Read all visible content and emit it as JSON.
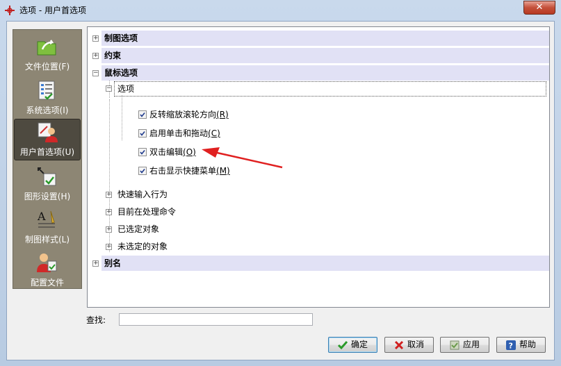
{
  "window": {
    "title": "选项 - 用户首选项",
    "close_label": "✕"
  },
  "nav": {
    "items": [
      {
        "label": "文件位置(F)",
        "icon": "folder-arrow-icon"
      },
      {
        "label": "系统选项(I)",
        "icon": "checklist-icon"
      },
      {
        "label": "用户首选项(U)",
        "icon": "user-preferences-icon",
        "selected": true
      },
      {
        "label": "图形设置(H)",
        "icon": "graphics-settings-icon"
      },
      {
        "label": "制图样式(L)",
        "icon": "drafting-style-icon"
      },
      {
        "label": "配置文件",
        "icon": "profile-user-icon"
      }
    ]
  },
  "tree": {
    "drawing_options": "制图选项",
    "constraints": "约束",
    "mouse_options": "鼠标选项",
    "options_node": "选项",
    "checkboxes": [
      {
        "text": "反转缩放滚轮方向",
        "key": "(R)",
        "checked": true
      },
      {
        "text": "启用单击和拖动",
        "key": "(C)",
        "checked": true
      },
      {
        "text": "双击编辑",
        "key": "(O)",
        "checked": true
      },
      {
        "text": "右击显示快捷菜单",
        "key": "(M)",
        "checked": true
      }
    ],
    "quick_input": "快速输入行为",
    "current_command": "目前在处理命令",
    "selected_objects": "已选定对象",
    "unselected_objects": "未选定的对象",
    "aliases": "别名"
  },
  "search": {
    "label": "查找:",
    "value": ""
  },
  "buttons": {
    "ok": "确定",
    "cancel": "取消",
    "apply": "应用",
    "help": "帮助"
  },
  "colors": {
    "category_bg": "#e1e1f5",
    "nav_bg": "#8d8674",
    "arrow": "#e02020"
  }
}
